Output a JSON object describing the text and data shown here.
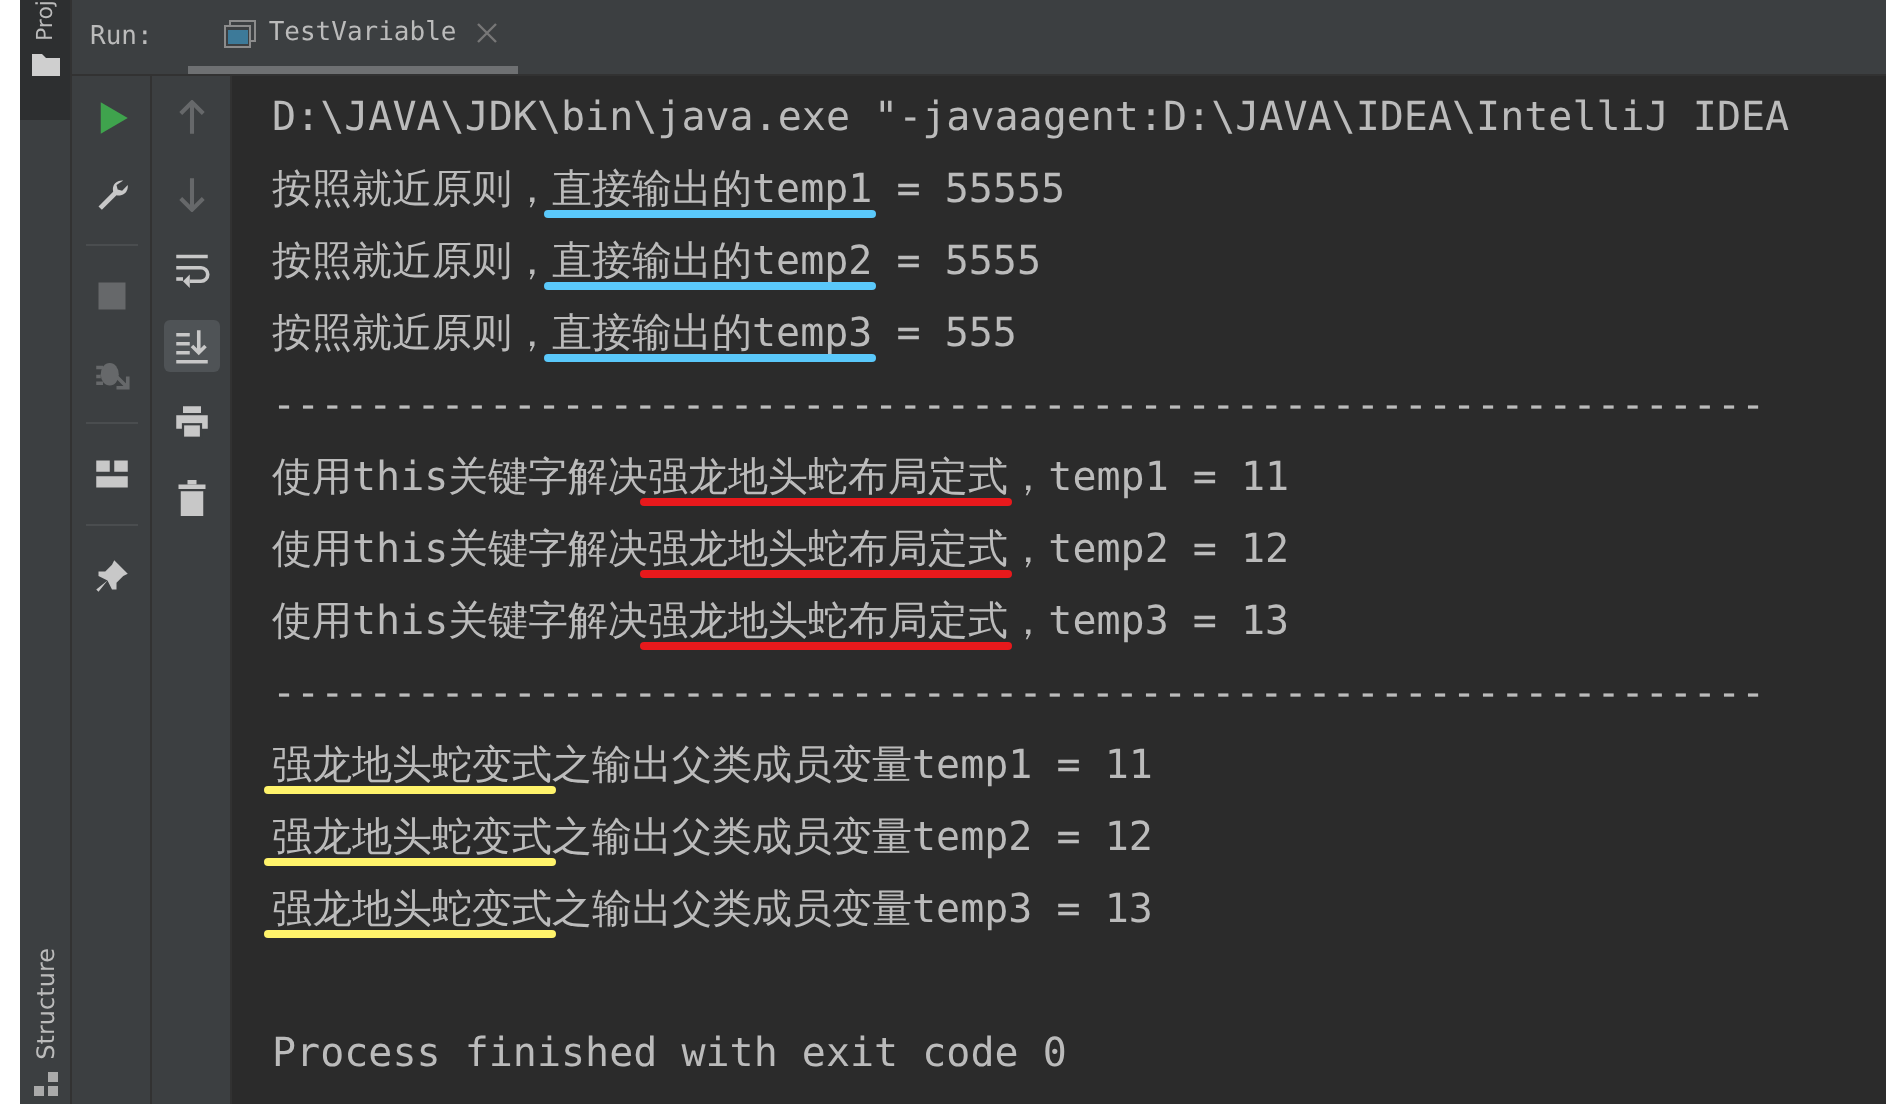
{
  "side_tabs": {
    "top": "Proj",
    "bottom": "Structure"
  },
  "run_bar": {
    "label": "Run:",
    "tabs": [
      {
        "title": "TestVariable",
        "selected": true
      }
    ]
  },
  "toolbar_1": [
    {
      "kind": "run",
      "disabled": false
    },
    {
      "kind": "wrench",
      "disabled": false
    },
    {
      "kind": "divider"
    },
    {
      "kind": "stop",
      "disabled": true
    },
    {
      "kind": "debug",
      "disabled": true
    },
    {
      "kind": "divider"
    },
    {
      "kind": "layout",
      "disabled": false
    },
    {
      "kind": "divider"
    },
    {
      "kind": "pin",
      "disabled": false
    }
  ],
  "toolbar_2": [
    {
      "kind": "up",
      "disabled": true,
      "selected": false
    },
    {
      "kind": "down",
      "disabled": true,
      "selected": false
    },
    {
      "kind": "wrap",
      "disabled": false,
      "selected": false
    },
    {
      "kind": "scroll-end",
      "disabled": false,
      "selected": true
    },
    {
      "kind": "print",
      "disabled": false,
      "selected": false
    },
    {
      "kind": "trash",
      "disabled": false,
      "selected": false
    }
  ],
  "console": [
    {
      "kind": "output",
      "parts": [
        {
          "text": "D:\\JAVA\\JDK\\bin\\java.exe \"-javaagent:D:\\JAVA\\IDEA\\IntelliJ IDEA"
        }
      ]
    },
    {
      "kind": "output",
      "parts": [
        {
          "text": "按照就近原则，"
        },
        {
          "text": "直接输出的temp1",
          "color": "#5ac8fa"
        },
        {
          "text": " = 55555"
        }
      ]
    },
    {
      "kind": "output",
      "parts": [
        {
          "text": "按照就近原则，"
        },
        {
          "text": "直接输出的temp2",
          "color": "#5ac8fa"
        },
        {
          "text": " = 5555"
        }
      ]
    },
    {
      "kind": "output",
      "parts": [
        {
          "text": "按照就近原则，"
        },
        {
          "text": "直接输出的temp3",
          "color": "#5ac8fa"
        },
        {
          "text": " = 555"
        }
      ]
    },
    {
      "kind": "output",
      "parts": [
        {
          "text": "--------------------------------------------------------------"
        }
      ]
    },
    {
      "kind": "output",
      "parts": [
        {
          "text": "使用this关键字解决"
        },
        {
          "text": "强龙地头蛇布局定式",
          "color": "#e8191c"
        },
        {
          "text": "，temp1 = 11"
        }
      ]
    },
    {
      "kind": "output",
      "parts": [
        {
          "text": "使用this关键字解决"
        },
        {
          "text": "强龙地头蛇布局定式",
          "color": "#e8191c"
        },
        {
          "text": "，temp2 = 12"
        }
      ]
    },
    {
      "kind": "output",
      "parts": [
        {
          "text": "使用this关键字解决"
        },
        {
          "text": "强龙地头蛇布局定式",
          "color": "#e8191c"
        },
        {
          "text": "，temp3 = 13"
        }
      ]
    },
    {
      "kind": "output",
      "parts": [
        {
          "text": "--------------------------------------------------------------"
        }
      ]
    },
    {
      "kind": "output",
      "parts": [
        {
          "text": "强龙地头蛇变式",
          "color": "#fff36b"
        },
        {
          "text": "之输出父类成员变量temp1 = 11"
        }
      ]
    },
    {
      "kind": "output",
      "parts": [
        {
          "text": "强龙地头蛇变式",
          "color": "#fff36b"
        },
        {
          "text": "之输出父类成员变量temp2 = 12"
        }
      ]
    },
    {
      "kind": "output",
      "parts": [
        {
          "text": "强龙地头蛇变式",
          "color": "#fff36b"
        },
        {
          "text": "之输出父类成员变量temp3 = 13"
        }
      ]
    },
    {
      "kind": "exit",
      "parts": [
        {
          "text": "Process finished with exit code 0"
        }
      ]
    }
  ]
}
